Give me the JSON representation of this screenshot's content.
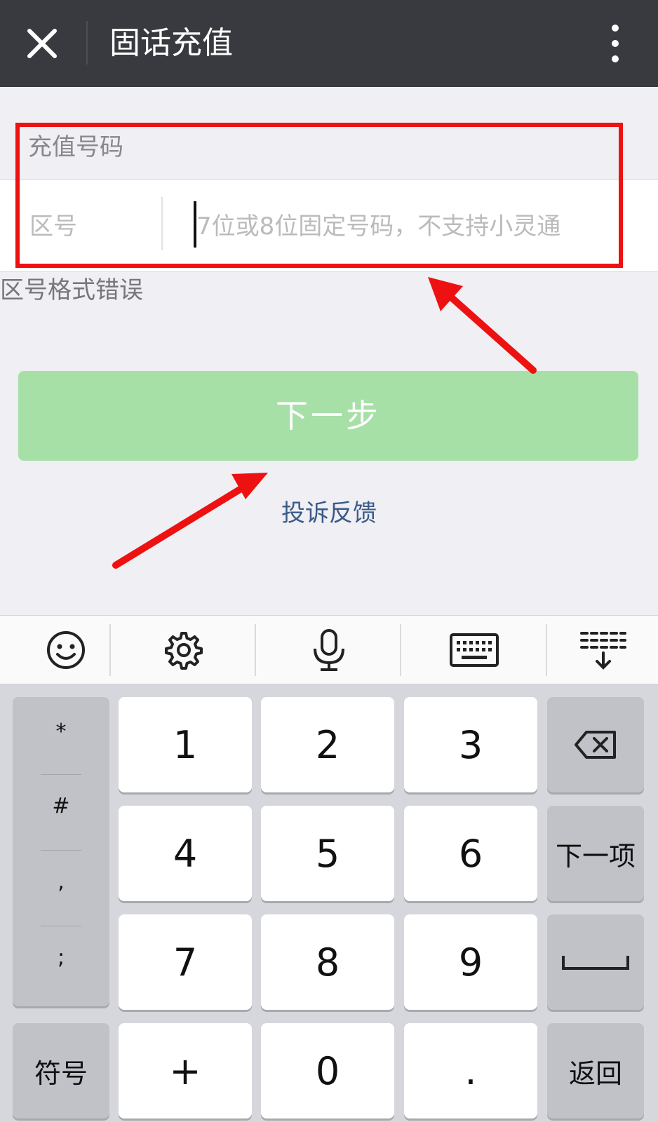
{
  "header": {
    "title": "固话充值",
    "close_icon": "close-icon",
    "more_icon": "more-vertical-icon",
    "background": "#393a3f"
  },
  "form": {
    "section_label": "充值号码",
    "area_code_placeholder": "区号",
    "phone_placeholder": "7位或8位固定号码，不支持小灵通",
    "error_message": "区号格式错误"
  },
  "actions": {
    "next_label": "下一步",
    "next_color": "#a6e0a6",
    "feedback_label": "投诉反馈"
  },
  "annotation": {
    "highlight_color": "#ee1111"
  },
  "keyboard_toolbar": {
    "items": [
      "emoji-icon",
      "settings-gear-icon",
      "microphone-icon",
      "keyboard-icon",
      "collapse-keyboard-icon"
    ]
  },
  "keyboard": {
    "symbols": [
      "*",
      "#",
      ",",
      ";"
    ],
    "digits": [
      "1",
      "2",
      "3",
      "4",
      "5",
      "6",
      "7",
      "8",
      "9"
    ],
    "symbol_key": "符号",
    "plus_key": "+",
    "zero_key": "0",
    "dot_key": ".",
    "next_item_key": "下一项",
    "return_key": "返回",
    "backspace_icon": "backspace-icon",
    "space_icon": "space-icon"
  }
}
